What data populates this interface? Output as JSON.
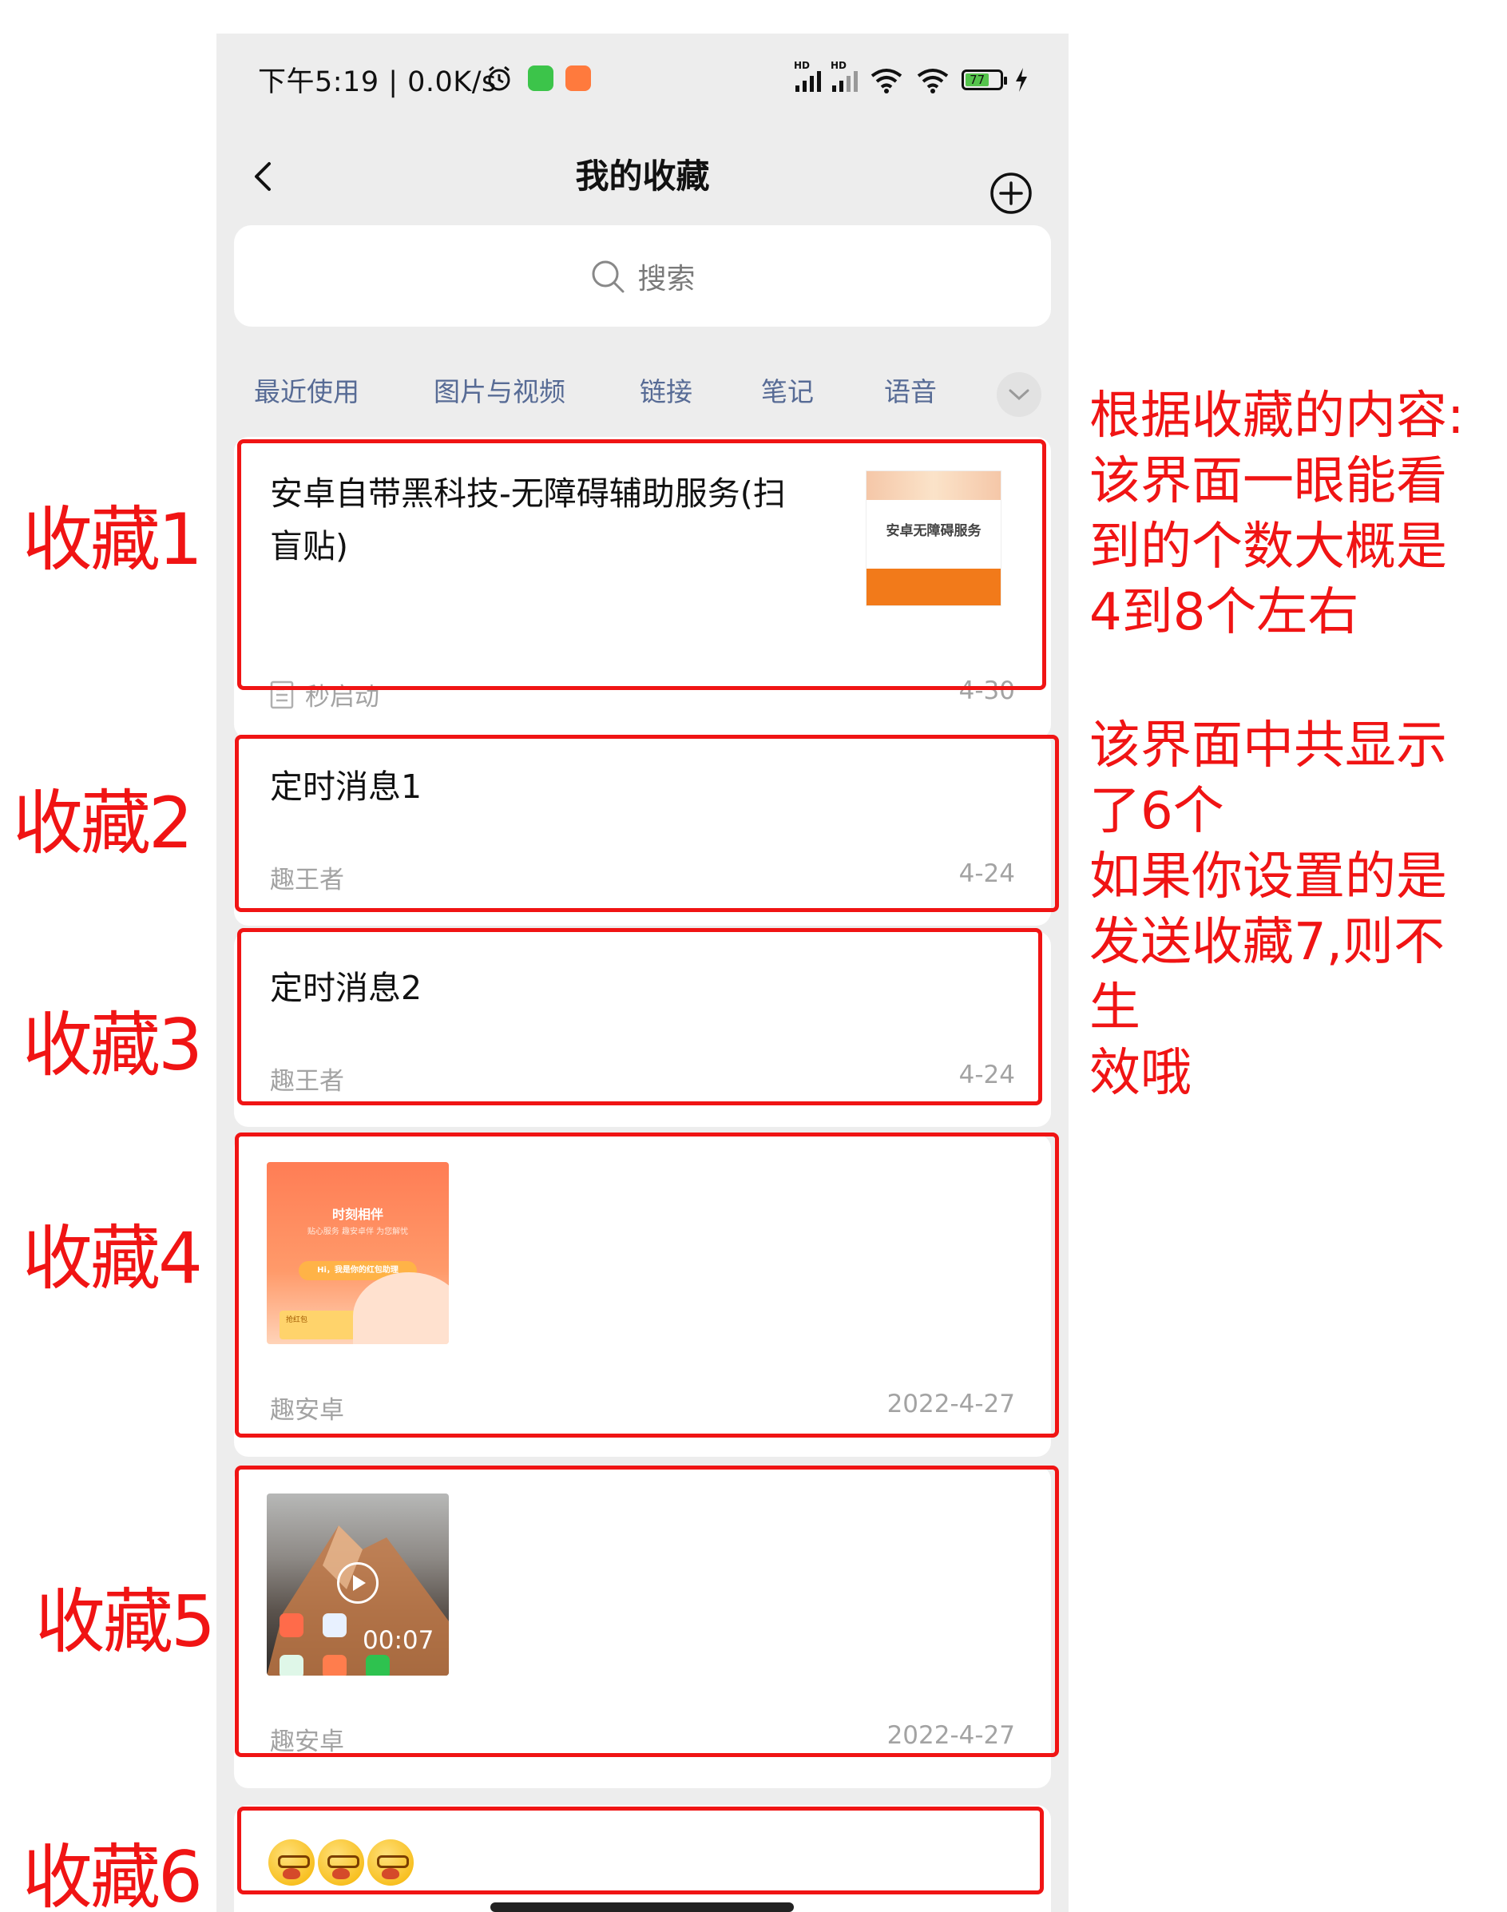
{
  "status_bar": {
    "time_speed": "下午5:19 | 0.0K/s",
    "battery": "77",
    "signal_badge": "HD"
  },
  "header": {
    "title": "我的收藏",
    "back_icon": "chevron-left-icon",
    "add_icon": "plus-circle-icon"
  },
  "search": {
    "placeholder": "搜索"
  },
  "tabs": [
    "最近使用",
    "图片与视频",
    "链接",
    "笔记",
    "语音"
  ],
  "items": [
    {
      "title": "安卓自带黑科技-无障碍辅助服务(扫盲贴)",
      "title_line1": "安卓自带黑科技-无障碍辅助服务(扫",
      "title_line2": "盲贴)",
      "source": "秒启动",
      "date": "4-30",
      "thumb_text": "安卓无障碍服务"
    },
    {
      "title": "定时消息1",
      "source": "趣王者",
      "date": "4-24"
    },
    {
      "title": "定时消息2",
      "source": "趣王者",
      "date": "4-24"
    },
    {
      "source": "趣安卓",
      "date": "2022-4-27",
      "thumb_title": "时刻相伴",
      "thumb_sub": "贴心服务 趣安卓伴 为您解忧",
      "thumb_pill": "Hi，我是你的红包助理",
      "thumb_tag": "抢红包"
    },
    {
      "source": "趣安卓",
      "date": "2022-4-27",
      "duration": "00:07"
    },
    {
      "emoji_count": 3
    }
  ],
  "annotations": {
    "labels": [
      "收藏1",
      "收藏2",
      "收藏3",
      "收藏4",
      "收藏5",
      "收藏6"
    ],
    "note1": "根据收藏的内容:\n该界面一眼能看\n到的个数大概是\n4到8个左右",
    "note2": "该界面中共显示\n了6个\n如果你设置的是\n发送收藏7,则不生\n效哦"
  },
  "colors": {
    "annotation_red": "#f01414",
    "tab_link": "#576b95",
    "background": "#ededed"
  }
}
